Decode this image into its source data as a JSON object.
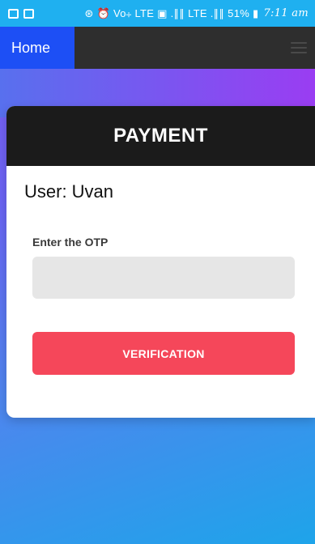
{
  "status_bar": {
    "indicators": "⊛ ⏰ Vo⧾ LTE ▣ .∥∥ LTE .∥∥ 51% ▮",
    "time": "7:11 am",
    "left_icons": [
      "image-icon",
      "message-icon"
    ]
  },
  "navbar": {
    "home_label": "Home",
    "menu_icon": "hamburger-menu-icon"
  },
  "card": {
    "title": "PAYMENT",
    "user_text": "User: Uvan",
    "otp_label": "Enter the OTP",
    "otp_value": "",
    "otp_placeholder": "",
    "verify_label": "VERIFICATION"
  },
  "colors": {
    "status_bar": "#1fb0f0",
    "nav_home": "#1d4ff5",
    "navbar": "#2e2e2e",
    "card_header": "#1b1b1b",
    "button": "#f5475a",
    "input_bg": "#e6e6e6"
  }
}
